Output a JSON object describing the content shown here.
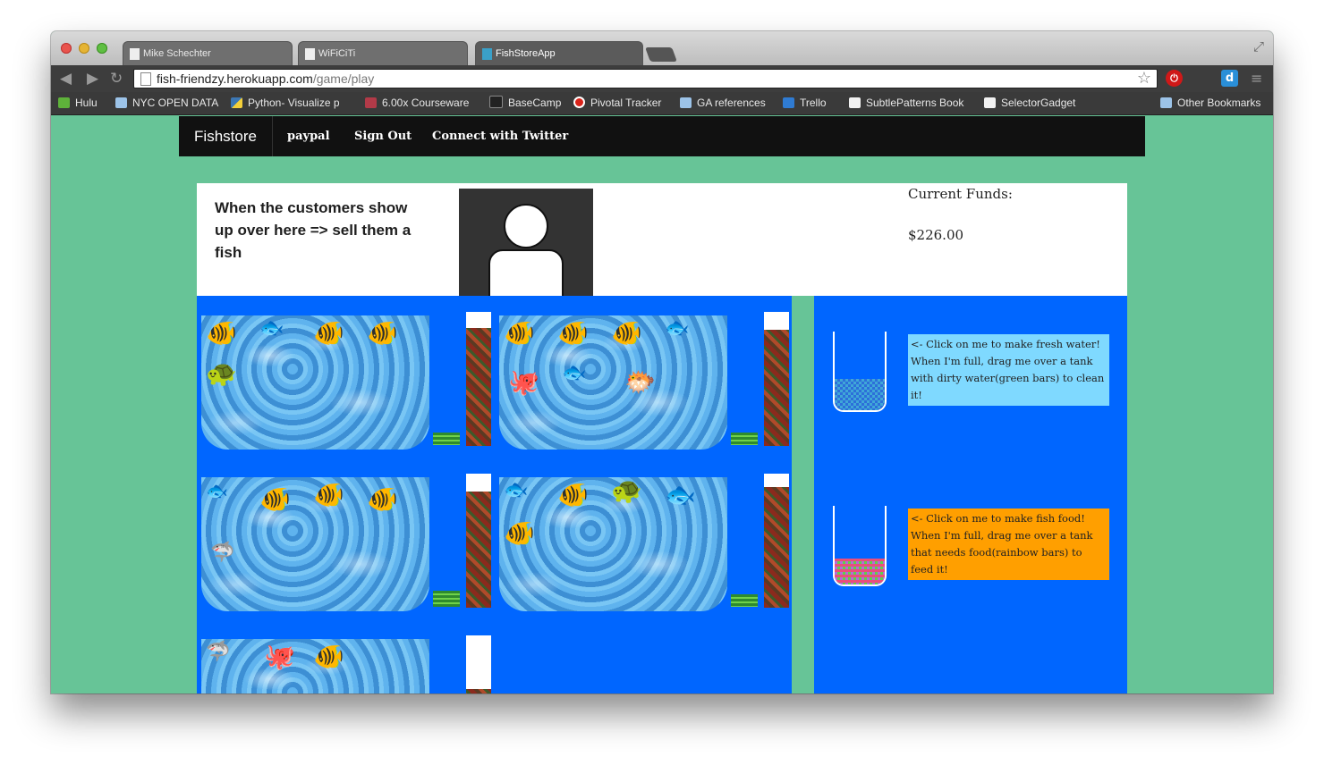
{
  "browser": {
    "tabs": [
      {
        "label": "Mike Schechter",
        "active": false
      },
      {
        "label": "WiFiCiTi",
        "active": false
      },
      {
        "label": "FishStoreApp",
        "active": true
      }
    ],
    "url": {
      "host": "fish-friendzy.herokuapp.com",
      "path": "/game/play"
    },
    "bookmarks": [
      {
        "label": "Hulu",
        "icon": "hulu-icon"
      },
      {
        "label": "NYC OPEN DATA",
        "icon": "folder-icon"
      },
      {
        "label": "Python- Visualize p",
        "icon": "python-icon"
      },
      {
        "label": "6.00x Courseware",
        "icon": "edx-icon"
      },
      {
        "label": "BaseCamp",
        "icon": "basecamp-icon"
      },
      {
        "label": "Pivotal Tracker",
        "icon": "pivotal-icon"
      },
      {
        "label": "GA references",
        "icon": "folder-icon"
      },
      {
        "label": "Trello",
        "icon": "trello-icon"
      },
      {
        "label": "SubtlePatterns Book",
        "icon": "page-icon"
      },
      {
        "label": "SelectorGadget",
        "icon": "page-icon"
      }
    ],
    "other_bookmarks": "Other Bookmarks"
  },
  "nav": {
    "brand": "Fishstore",
    "links": [
      "paypal",
      "Sign Out",
      "Connect with Twitter"
    ]
  },
  "customer": {
    "message": "When the customers show up over here => sell them a fish"
  },
  "funds": {
    "label": "Current Funds:",
    "value": "$226.00"
  },
  "tanks": [
    {
      "fish": [
        "🐠",
        "🐟",
        "🐠",
        "🐠",
        "🐢"
      ],
      "water_level": 0.1,
      "food_level": 0.88
    },
    {
      "fish": [
        "🐠",
        "🐠",
        "🐠",
        "🐟",
        "🐙",
        "🐟",
        "🐡"
      ],
      "water_level": 0.1,
      "food_level": 0.87
    },
    {
      "fish": [
        "🐟",
        "🐠",
        "🐠",
        "🐠",
        "🦈"
      ],
      "water_level": 0.13,
      "food_level": 0.87
    },
    {
      "fish": [
        "🐟",
        "🐠",
        "🐢",
        "🐟",
        "🐠"
      ],
      "water_level": 0.1,
      "food_level": 0.9
    },
    {
      "fish": [
        "🦈",
        "🐙",
        "🐠"
      ],
      "water_level": 0,
      "food_level": 0.6
    }
  ],
  "tools": {
    "water_tip": "<- Click on me to make fresh water! When I'm full, drag me over a tank with dirty water(green bars) to clean it!",
    "food_tip": "<- Click on me to make fish food! When I'm full, drag me over a tank that needs food(rainbow bars) to feed it!",
    "water_jar_level": 0.4,
    "food_jar_level": 0.33
  },
  "colors": {
    "page_bg": "#67c497",
    "game_bg": "#0066ff",
    "water_tip_bg": "#7fd9ff",
    "food_tip_bg": "#ff9f00"
  }
}
